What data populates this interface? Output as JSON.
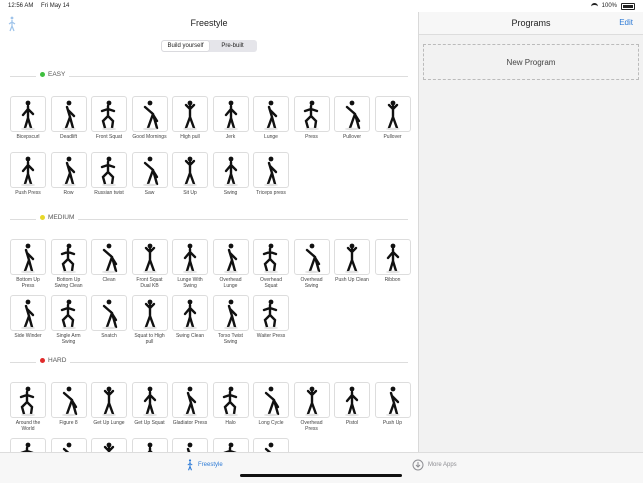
{
  "status": {
    "time": "12:56 AM",
    "date": "Fri May 14",
    "battery": "100%"
  },
  "main": {
    "title": "Freestyle",
    "segments": [
      {
        "label": "Build yourself",
        "active": true
      },
      {
        "label": "Pre-built",
        "active": false
      }
    ],
    "sections": [
      {
        "name": "EASY",
        "color": "#3fbf3f",
        "items": [
          "Bicepscurl",
          "Deadlift",
          "Front Squat",
          "Good Mornings",
          "High pull",
          "Jerk",
          "Lunge",
          "Press",
          "Pullover",
          "Pullover",
          "Push Press",
          "Row",
          "Russian twist",
          "Saw",
          "Sit Up",
          "Swing",
          "Triceps press"
        ]
      },
      {
        "name": "MEDIUM",
        "color": "#e7d82a",
        "items": [
          "Bottom Up Press",
          "Bottom Up Swing Clean",
          "Clean",
          "Front Squat Dual KB",
          "Lunge With Swing",
          "Overhead Lunge",
          "Overhead Squat",
          "Overhead Swing",
          "Push Up Clean",
          "Ribbon",
          "Side Winder",
          "Single Arm Swing",
          "Snatch",
          "Squat to High pull",
          "Swing Clean",
          "Torso Twist Swing",
          "Waiter Press"
        ]
      },
      {
        "name": "HARD",
        "color": "#e02b2b",
        "items": [
          "Around the World",
          "Figure 8",
          "Get Up Lunge",
          "Get Up Squat",
          "Gladiator Press",
          "Halo",
          "Long Cycle",
          "Overhead Press",
          "Pistol",
          "Push Up",
          "",
          "",
          "",
          "",
          "",
          "",
          ""
        ]
      }
    ]
  },
  "tabs": {
    "freestyle": "Freestyle",
    "more": "More Apps"
  },
  "side": {
    "title": "Programs",
    "edit": "Edit",
    "new_program": "New Program"
  },
  "colors": {
    "accent": "#2e7bd6"
  }
}
